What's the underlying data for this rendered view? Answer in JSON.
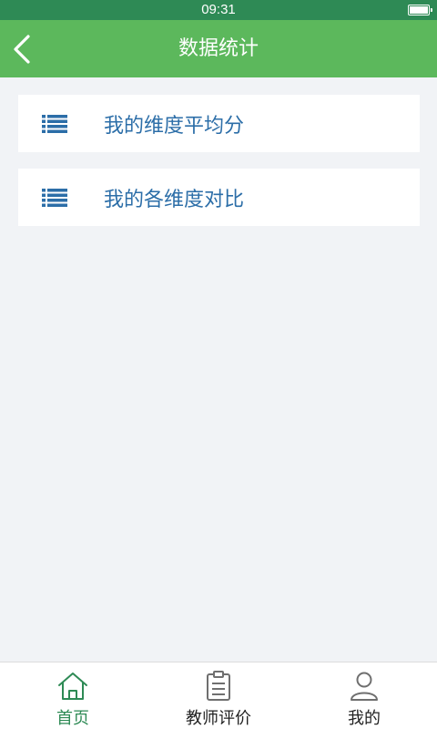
{
  "status_bar": {
    "time": "09:31"
  },
  "nav": {
    "title": "数据统计",
    "back_icon": "chevron-left-icon"
  },
  "list": [
    {
      "label": "我的维度平均分",
      "icon": "list-icon"
    },
    {
      "label": "我的各维度对比",
      "icon": "list-icon"
    }
  ],
  "tabs": [
    {
      "label": "首页",
      "icon": "home-icon",
      "active": true
    },
    {
      "label": "教师评价",
      "icon": "clipboard-icon",
      "active": false
    },
    {
      "label": "我的",
      "icon": "user-icon",
      "active": false
    }
  ],
  "colors": {
    "status_bar": "#2e8a55",
    "nav_bar": "#5cb85c",
    "accent_blue": "#2c6ea8",
    "tab_active": "#2e8a55",
    "background": "#f1f3f6"
  }
}
